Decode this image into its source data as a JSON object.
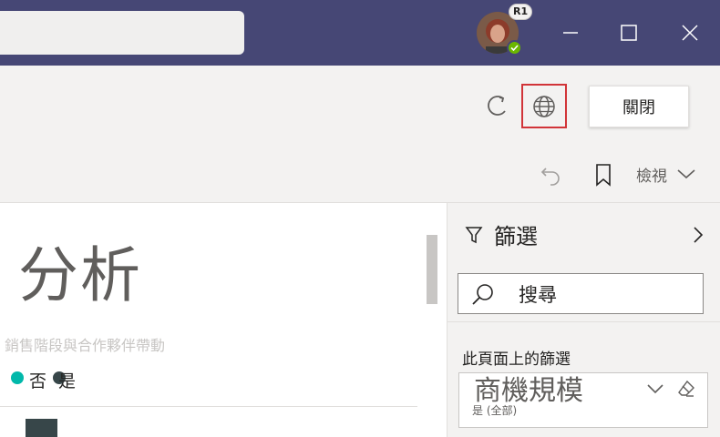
{
  "titlebar": {
    "avatar_badge": "R1",
    "status": "available",
    "colors": {
      "background": "#464775",
      "status": "#6bb700"
    }
  },
  "toolbar": {
    "close_label": "關閉",
    "view_label": "檢視",
    "icons": [
      "refresh-icon",
      "globe-icon",
      "undo-icon",
      "bookmark-icon",
      "chevron-down-icon"
    ],
    "highlight_color": "#d13438"
  },
  "report": {
    "title": "分析",
    "subtitle": "銷售階段與合作夥伴帶動",
    "legend": [
      {
        "label": "否",
        "color": "#01b8aa"
      },
      {
        "label": "是",
        "color": "#374649"
      }
    ]
  },
  "filters": {
    "title": "篩選",
    "search_placeholder": "搜尋",
    "section_label": "此頁面上的篩選",
    "card": {
      "title": "商機規模",
      "value": "是 (全部)"
    }
  }
}
